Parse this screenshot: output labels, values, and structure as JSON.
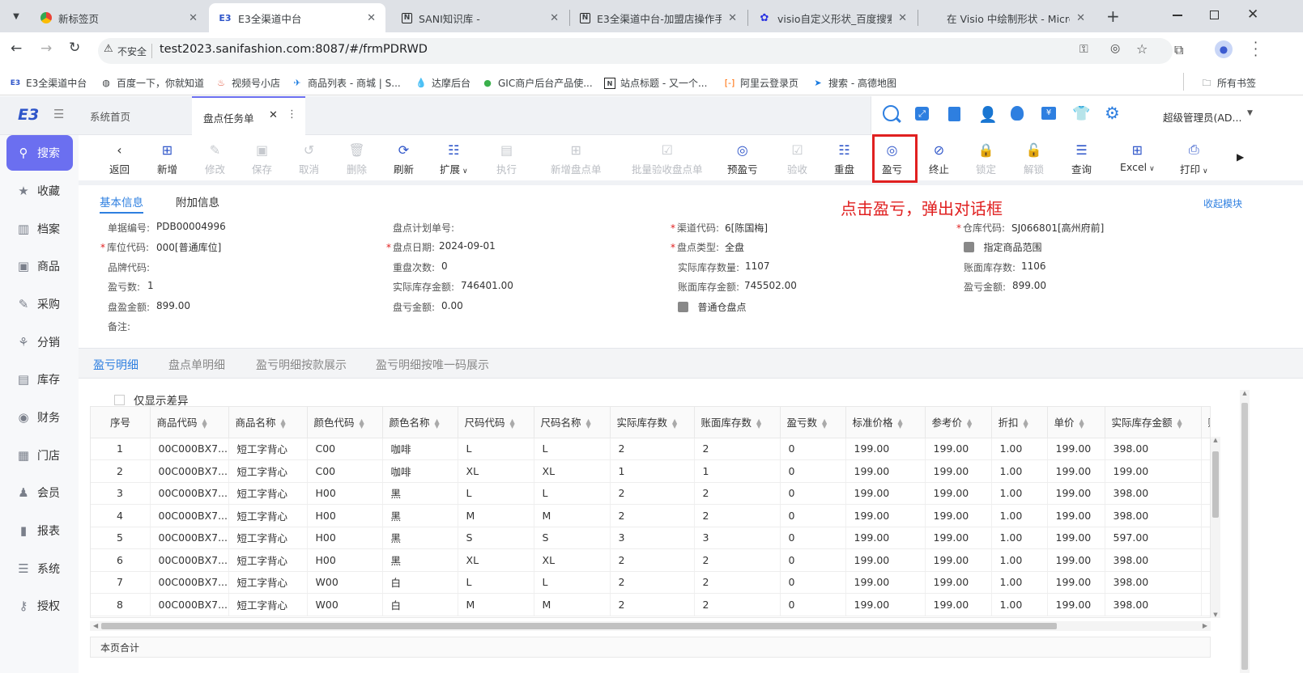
{
  "browser": {
    "tabs": [
      {
        "title": "新标签页",
        "icon": "chrome-icon"
      },
      {
        "title": "E3全渠道中台",
        "icon": "e3-icon"
      },
      {
        "title": "SANI知识库 -",
        "icon": "notion-icon"
      },
      {
        "title": "E3全渠道中台-加盟店操作手",
        "icon": "notion-icon"
      },
      {
        "title": "visio自定义形状_百度搜索",
        "icon": "baidu-icon"
      },
      {
        "title": "在 Visio 中绘制形状 - Micro",
        "icon": "microsoft-icon"
      }
    ],
    "security_label": "不安全",
    "url": "test2023.sanifashion.com:8087/#/frmPDRWD",
    "bookmarks": [
      "E3全渠道中台",
      "百度一下，你就知道",
      "视频号小店",
      "商品列表 - 商城 | S...",
      "达摩后台",
      "GIC商户后台产品使...",
      "站点标题 - 又一个...",
      "阿里云登录页",
      "搜索 - 高德地图"
    ],
    "all_bookmarks": "所有书签"
  },
  "app": {
    "logo": "E3",
    "page_tabs": [
      "系统首页",
      "盘点任务单"
    ],
    "user": "超级管理员(AD..."
  },
  "sidebar": [
    "搜索",
    "收藏",
    "档案",
    "商品",
    "采购",
    "分销",
    "库存",
    "财务",
    "门店",
    "会员",
    "报表",
    "系统",
    "授权"
  ],
  "toolbar": [
    {
      "label": "返回",
      "icon": "back-icon"
    },
    {
      "label": "新增",
      "icon": "add-icon"
    },
    {
      "label": "修改",
      "icon": "edit-icon"
    },
    {
      "label": "保存",
      "icon": "save-icon"
    },
    {
      "label": "取消",
      "icon": "undo-icon"
    },
    {
      "label": "删除",
      "icon": "delete-icon"
    },
    {
      "label": "刷新",
      "icon": "refresh-icon"
    },
    {
      "label": "扩展",
      "icon": "extend-icon"
    },
    {
      "label": "执行",
      "icon": "execute-icon"
    },
    {
      "label": "新增盘点单",
      "icon": "add-doc-icon"
    },
    {
      "label": "批量验收盘点单",
      "icon": "batch-check-icon"
    },
    {
      "label": "预盈亏",
      "icon": "pre-profit-icon"
    },
    {
      "label": "验收",
      "icon": "check-icon"
    },
    {
      "label": "重盘",
      "icon": "recount-icon"
    },
    {
      "label": "盈亏",
      "icon": "profit-loss-icon"
    },
    {
      "label": "终止",
      "icon": "terminate-icon"
    },
    {
      "label": "锁定",
      "icon": "lock-icon"
    },
    {
      "label": "解锁",
      "icon": "unlock-icon"
    },
    {
      "label": "查询",
      "icon": "query-icon"
    },
    {
      "label": "Excel",
      "icon": "excel-icon"
    },
    {
      "label": "打印",
      "icon": "print-icon"
    }
  ],
  "annotation": "点击盈亏，弹出对话框",
  "form": {
    "tabs": [
      "基本信息",
      "附加信息"
    ],
    "collapse": "收起模块",
    "fields": [
      {
        "label": "单据编号:",
        "value": "PDB00004996"
      },
      {
        "label": "盘点计划单号:",
        "value": ""
      },
      {
        "label": "渠道代码:",
        "value": "6[陈国梅]"
      },
      {
        "label": "仓库代码:",
        "value": "SJ066801[高州府前]"
      },
      {
        "label": "库位代码:",
        "value": "000[普通库位]"
      },
      {
        "label": "盘点日期:",
        "value": "2024-09-01"
      },
      {
        "label": "盘点类型:",
        "value": "全盘"
      },
      {
        "label": "指定商品范围",
        "value": ""
      },
      {
        "label": "品牌代码:",
        "value": ""
      },
      {
        "label": "重盘次数:",
        "value": "0"
      },
      {
        "label": "实际库存数量:",
        "value": "1107"
      },
      {
        "label": "账面库存数:",
        "value": "1106"
      },
      {
        "label": "盈亏数:",
        "value": "1"
      },
      {
        "label": "实际库存金额:",
        "value": "746401.00"
      },
      {
        "label": "账面库存金额:",
        "value": "745502.00"
      },
      {
        "label": "盈亏金额:",
        "value": "899.00"
      },
      {
        "label": "盘盈金额:",
        "value": "899.00"
      },
      {
        "label": "盘亏金额:",
        "value": "0.00"
      },
      {
        "label": "普通仓盘点",
        "value": ""
      },
      {
        "label": "备注:",
        "value": ""
      }
    ]
  },
  "detail": {
    "tabs": [
      "盈亏明细",
      "盘点单明细",
      "盈亏明细按款展示",
      "盈亏明细按唯一码展示"
    ],
    "only_diff": "仅显示差异",
    "columns": [
      "序号",
      "商品代码",
      "商品名称",
      "颜色代码",
      "颜色名称",
      "尺码代码",
      "尺码名称",
      "实际库存数",
      "账面库存数",
      "盈亏数",
      "标准价格",
      "参考价",
      "折扣",
      "单价",
      "实际库存金额",
      "账面"
    ],
    "rows": [
      [
        "1",
        "00C000BX7...",
        "短工字背心",
        "C00",
        "咖啡",
        "L",
        "L",
        "2",
        "2",
        "0",
        "199.00",
        "199.00",
        "1.00",
        "199.00",
        "398.00"
      ],
      [
        "2",
        "00C000BX7...",
        "短工字背心",
        "C00",
        "咖啡",
        "XL",
        "XL",
        "1",
        "1",
        "0",
        "199.00",
        "199.00",
        "1.00",
        "199.00",
        "199.00"
      ],
      [
        "3",
        "00C000BX7...",
        "短工字背心",
        "H00",
        "黑",
        "L",
        "L",
        "2",
        "2",
        "0",
        "199.00",
        "199.00",
        "1.00",
        "199.00",
        "398.00"
      ],
      [
        "4",
        "00C000BX7...",
        "短工字背心",
        "H00",
        "黑",
        "M",
        "M",
        "2",
        "2",
        "0",
        "199.00",
        "199.00",
        "1.00",
        "199.00",
        "398.00"
      ],
      [
        "5",
        "00C000BX7...",
        "短工字背心",
        "H00",
        "黑",
        "S",
        "S",
        "3",
        "3",
        "0",
        "199.00",
        "199.00",
        "1.00",
        "199.00",
        "597.00"
      ],
      [
        "6",
        "00C000BX7...",
        "短工字背心",
        "H00",
        "黑",
        "XL",
        "XL",
        "2",
        "2",
        "0",
        "199.00",
        "199.00",
        "1.00",
        "199.00",
        "398.00"
      ],
      [
        "7",
        "00C000BX7...",
        "短工字背心",
        "W00",
        "白",
        "L",
        "L",
        "2",
        "2",
        "0",
        "199.00",
        "199.00",
        "1.00",
        "199.00",
        "398.00"
      ],
      [
        "8",
        "00C000BX7...",
        "短工字背心",
        "W00",
        "白",
        "M",
        "M",
        "2",
        "2",
        "0",
        "199.00",
        "199.00",
        "1.00",
        "199.00",
        "398.00"
      ]
    ],
    "footer": "本页合计"
  }
}
